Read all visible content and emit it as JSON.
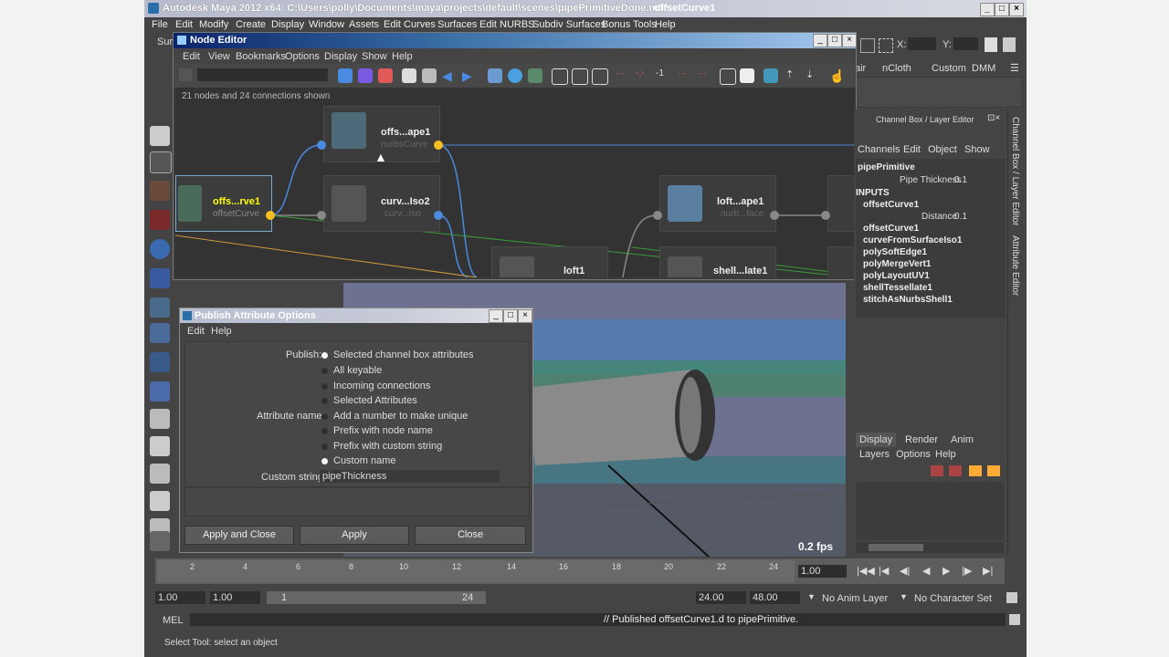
{
  "window": {
    "title": "Autodesk Maya 2012 x64: C:\\Users\\polly\\Documents\\maya\\projects\\default\\scenes\\pipePrimitiveDone.mb*",
    "selection": "offsetCurve1"
  },
  "menubar": [
    "File",
    "Edit",
    "Modify",
    "Create",
    "Display",
    "Window",
    "Assets",
    "Edit Curves",
    "Surfaces",
    "Edit NURBS",
    "Subdiv Surfaces",
    "Bonus Tools",
    "Help"
  ],
  "shelf_tabs": [
    "Surf",
    "air",
    "nCloth",
    "Custom",
    "DMM"
  ],
  "status_line": {
    "x_label": "X:",
    "y_label": "Y:"
  },
  "node_editor": {
    "title": "Node Editor",
    "menu": [
      "Edit",
      "View",
      "Bookmarks",
      "Options",
      "Display",
      "Show",
      "Help"
    ],
    "info": "21 nodes and 24 connections shown",
    "nodes": [
      {
        "name": "offs...ape1",
        "sub": "nurbsCurve"
      },
      {
        "name": "offs...rve1",
        "sub": "offsetCurve"
      },
      {
        "name": "curv...Iso2",
        "sub": "curv...Iso"
      },
      {
        "name": "loft...ape1",
        "sub": "nurb...face"
      },
      {
        "name": "loft1",
        "sub": ""
      },
      {
        "name": "shell...late1",
        "sub": ""
      }
    ]
  },
  "publish_dialog": {
    "title": "Publish Attribute Options",
    "menu": [
      "Edit",
      "Help"
    ],
    "publish_label": "Publish:",
    "publish_options": [
      {
        "label": "Selected channel box attributes",
        "selected": true
      },
      {
        "label": "All keyable",
        "selected": false
      },
      {
        "label": "Incoming connections",
        "selected": false
      },
      {
        "label": "Selected Attributes",
        "selected": false
      }
    ],
    "attr_name_label": "Attribute name:",
    "attr_name_options": [
      {
        "label": "Add a number to make unique",
        "selected": false
      },
      {
        "label": "Prefix with node name",
        "selected": false
      },
      {
        "label": "Prefix with custom string",
        "selected": false
      },
      {
        "label": "Custom name",
        "selected": true
      }
    ],
    "custom_string_label": "Custom string:",
    "custom_string_value": "pipeThickness",
    "buttons": {
      "apply_close": "Apply and Close",
      "apply": "Apply",
      "close": "Close"
    }
  },
  "viewport": {
    "fps": "0.2 fps"
  },
  "channel_box": {
    "title": "Channel Box / Layer Editor",
    "menu": [
      "Channels",
      "Edit",
      "Object",
      "Show"
    ],
    "object": "pipePrimitive",
    "attr_row": {
      "label": "Pipe Thickness",
      "value": "0.1"
    },
    "inputs_label": "INPUTS",
    "input_node": "offsetCurve1",
    "input_attr": {
      "label": "Distance",
      "value": "0.1"
    },
    "history": [
      "offsetCurve1",
      "curveFromSurfaceIso1",
      "polySoftEdge1",
      "polyMergeVert1",
      "polyLayoutUV1",
      "shellTessellate1",
      "stitchAsNurbsShell1"
    ]
  },
  "layer_editor": {
    "tabs": [
      "Display",
      "Render",
      "Anim"
    ],
    "menu": [
      "Layers",
      "Options",
      "Help"
    ]
  },
  "side_tabs": [
    "Channel Box / Layer Editor",
    "Attribute Editor"
  ],
  "timeline": {
    "ticks": [
      "2",
      "4",
      "6",
      "8",
      "10",
      "12",
      "14",
      "16",
      "18",
      "20",
      "22",
      "24"
    ],
    "current": "1.00"
  },
  "range": {
    "start": "1.00",
    "start2": "1.00",
    "slider_min": "1",
    "slider_max": "24",
    "end": "24.00",
    "end2": "48.00",
    "anim_layer": "No Anim Layer",
    "character": "No Character Set"
  },
  "command_line": {
    "label": "MEL",
    "result": "// Published offsetCurve1.d to pipePrimitive."
  },
  "help_line": "Select Tool: select an object"
}
